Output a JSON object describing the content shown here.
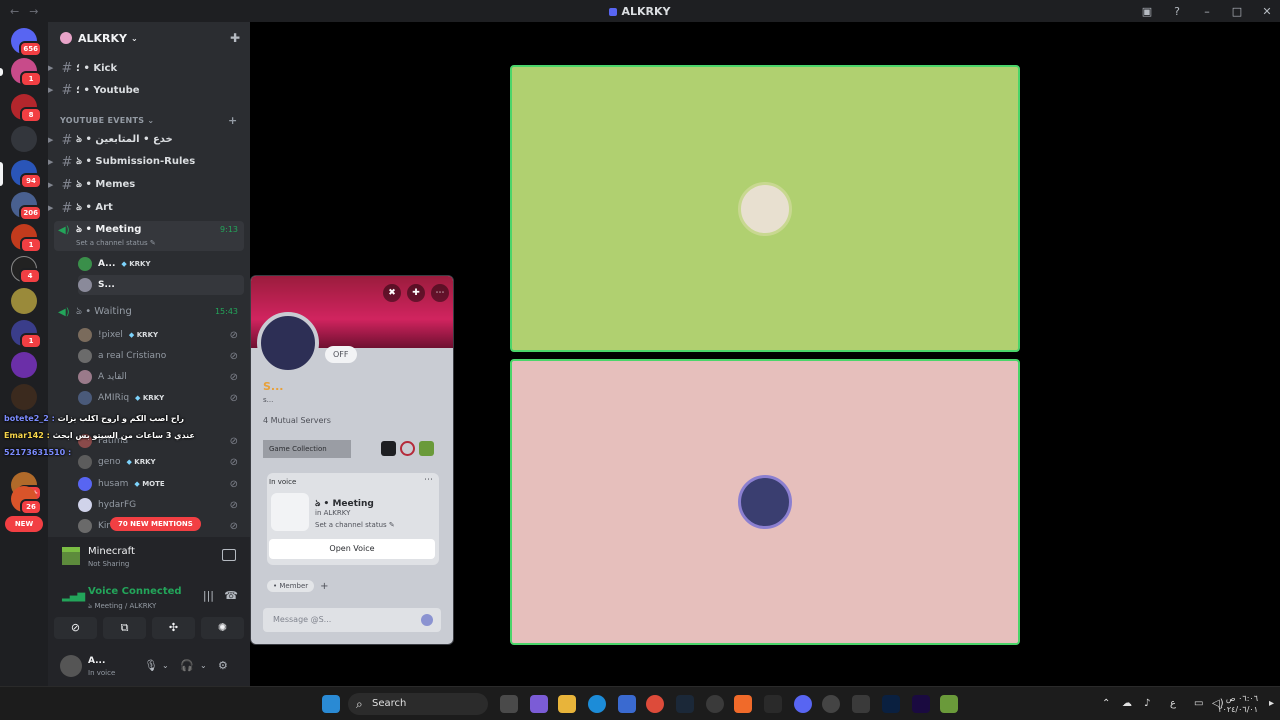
{
  "window": {
    "title": "ALKRKY"
  },
  "servers": [
    {
      "badge": "656"
    },
    {
      "badge": "1"
    },
    {
      "badge": "8"
    },
    {
      "badge": ""
    },
    {
      "badge": "94"
    },
    {
      "badge": "206"
    },
    {
      "badge": "1"
    },
    {
      "badge": "4"
    },
    {
      "badge": ""
    },
    {
      "badge": "1"
    },
    {
      "badge": ""
    },
    {
      "badge": ""
    },
    {
      "badge": "7K+"
    },
    {
      "badge": "26"
    },
    {
      "badge": "NEW"
    }
  ],
  "guild": {
    "name": "ALKRKY"
  },
  "channels": {
    "kick": "؛ • Kick",
    "youtube": "؛ • Youtube",
    "category": "YOUTUBE EVENTS",
    "tricks": "ঌ • خدع • المتابعين",
    "submission": "ঌ • Submission-Rules",
    "memes": "ঌ • Memes",
    "art": "ঌ • Art"
  },
  "meeting": {
    "name": "ঌ • Meeting",
    "time": "9:13",
    "status": "Set a channel status",
    "members": [
      {
        "name": "A...",
        "tag": "KRKY"
      },
      {
        "name": "S..."
      }
    ]
  },
  "waiting": {
    "name": "ঌ • Waiting",
    "time": "15:43",
    "members": [
      {
        "name": "!pixel",
        "tag": "KRKY"
      },
      {
        "name": "a real Cristiano"
      },
      {
        "name": "A القايد"
      },
      {
        "name": "AMIRiq",
        "tag": "KRKY"
      },
      {
        "name": "Fatima"
      },
      {
        "name": "geno",
        "tag": "KRKY"
      },
      {
        "name": "husam",
        "tag": "MOTE"
      },
      {
        "name": "hydarFG"
      },
      {
        "name": "Kir"
      }
    ],
    "mentions": "70 NEW MENTIONS"
  },
  "overlay_chat": [
    {
      "user": "botete2_2 :",
      "text": "راح اصب الكم و اروح اكلب بزات"
    },
    {
      "user": "Emar142 :",
      "text": "عندي 3 ساعات من السيتو بس ابحث"
    },
    {
      "user": "52173631510 :",
      "text": ""
    }
  ],
  "activity": {
    "game": "Minecraft",
    "status": "Not Sharing"
  },
  "voice": {
    "status": "Voice Connected",
    "location": "ঌ Meeting / ALKRKY"
  },
  "user": {
    "name": "A...",
    "status": "In voice"
  },
  "profile": {
    "off_label": "OFF",
    "username": "S...",
    "handle": "s...",
    "mutual": "4 Mutual Servers",
    "game_collection": "Game Collection",
    "in_voice_label": "In voice",
    "voice_channel": "ঌ • Meeting",
    "voice_server": "in ALKRKY",
    "voice_status": "Set a channel status",
    "open_voice": "Open Voice",
    "role": "• Member",
    "message_placeholder": "Message @S..."
  },
  "taskbar": {
    "search": "Search",
    "time": "٠٦:٠٦ ص",
    "date": "٢٠٢٤/٠٦/٠١",
    "lang": "ع"
  },
  "colors": {
    "speaking_border": "#4bd56a",
    "tile_top": "#b0d070",
    "tile_bottom": "#e6bfbc",
    "mention_red": "#f23f43",
    "voice_green": "#23a55a"
  }
}
